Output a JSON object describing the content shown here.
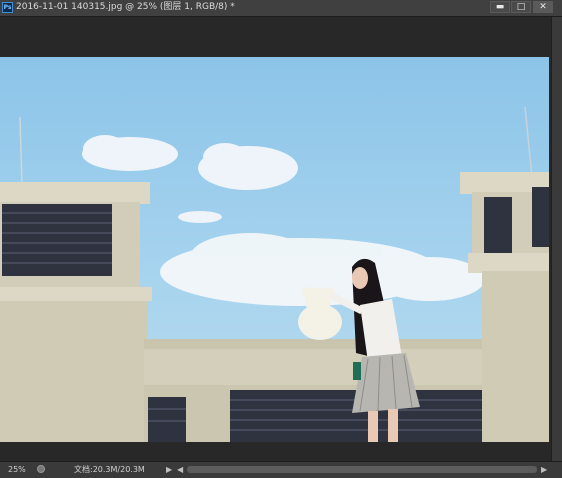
{
  "titlebar": {
    "app_icon": "Ps",
    "title": "2016-11-01 140315.jpg @ 25% (图层 1, RGB/8) *",
    "minimize_label": "▬",
    "maximize_label": "□",
    "close_label": "✕"
  },
  "status": {
    "zoom": "25%",
    "doc_info": "文档:20.3M/20.3M",
    "right_arrow": "▶",
    "left_arrow": "◀"
  },
  "colors": {
    "sky": "#a6d3ee",
    "building": "#d8d4c0",
    "vents": "#2e3240",
    "ui_bg": "#282828"
  }
}
